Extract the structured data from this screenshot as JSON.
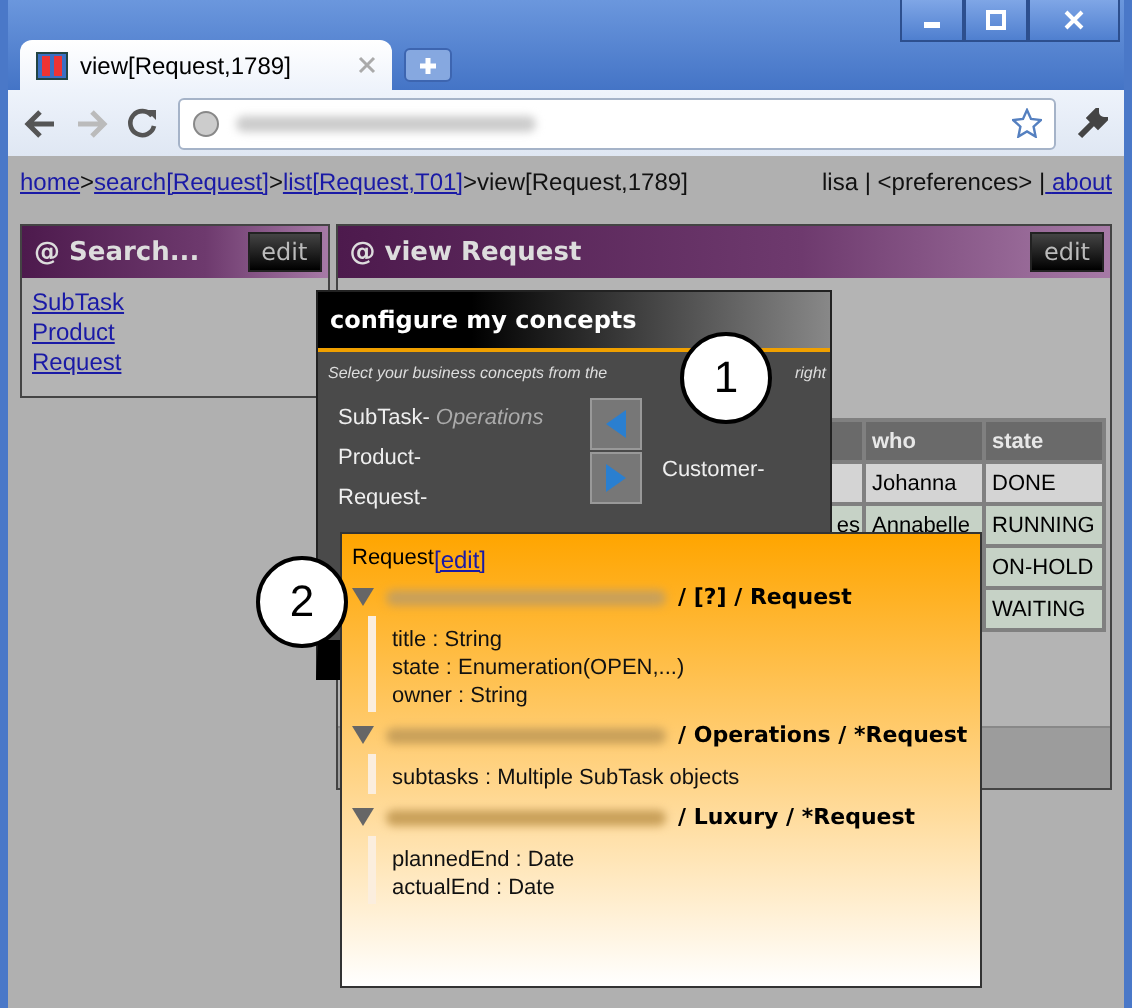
{
  "browser": {
    "tab": {
      "title": "view[Request,1789]"
    }
  },
  "breadcrumb": [
    {
      "label": "home",
      "kind": "link"
    },
    {
      "label": ">",
      "kind": "text"
    },
    {
      "label": "search[Request]",
      "kind": "link"
    },
    {
      "label": ">",
      "kind": "text"
    },
    {
      "label": "list[Request,T01]",
      "kind": "link"
    },
    {
      "label": ">view[Request,1789]",
      "kind": "text"
    }
  ],
  "user_menu": [
    {
      "label": "lisa | <preferences> |",
      "kind": "text"
    },
    {
      "label": "about",
      "kind": "link"
    }
  ],
  "search_panel": {
    "title": "@ Search...",
    "edit_button": "edit",
    "items": [
      "SubTask",
      "Product",
      "Request"
    ]
  },
  "view_panel": {
    "title": "@ view Request",
    "edit_button": "edit",
    "table": {
      "columns": [
        "who",
        "state"
      ],
      "rows": [
        {
          "who": "Johanna",
          "state": "DONE"
        },
        {
          "column_1": "es",
          "who": "Annabelle",
          "state": "RUNNING"
        },
        {
          "state": "ON-HOLD"
        },
        {
          "state": "WAITING"
        }
      ]
    }
  },
  "concepts_panel": {
    "title": "configure my concepts",
    "subtitle_start": "Select your business concepts from the",
    "subtitle_end": "right",
    "left_items": [
      {
        "name": "SubTask-",
        "tag": "Operations"
      },
      {
        "name": "Product-"
      },
      {
        "name": "Request-"
      }
    ],
    "right_items": [
      "Customer-"
    ]
  },
  "concept_popup": {
    "header": "Request",
    "edit_link": "[edit]",
    "sections": [
      {
        "path": "/ [?] / Request",
        "expanded": true,
        "fields": [
          "title : String",
          "state : Enumeration(OPEN,...)",
          "owner : String"
        ]
      },
      {
        "path": "/ Operations / *Request",
        "expanded": true,
        "fields": [
          "subtasks : Multiple SubTask objects"
        ]
      },
      {
        "path": "/ Luxury / *Request",
        "expanded": true,
        "fields": [
          "plannedEnd : Date",
          "actualEnd : Date"
        ]
      }
    ]
  },
  "callouts": [
    {
      "number": "1"
    },
    {
      "number": "2"
    }
  ]
}
